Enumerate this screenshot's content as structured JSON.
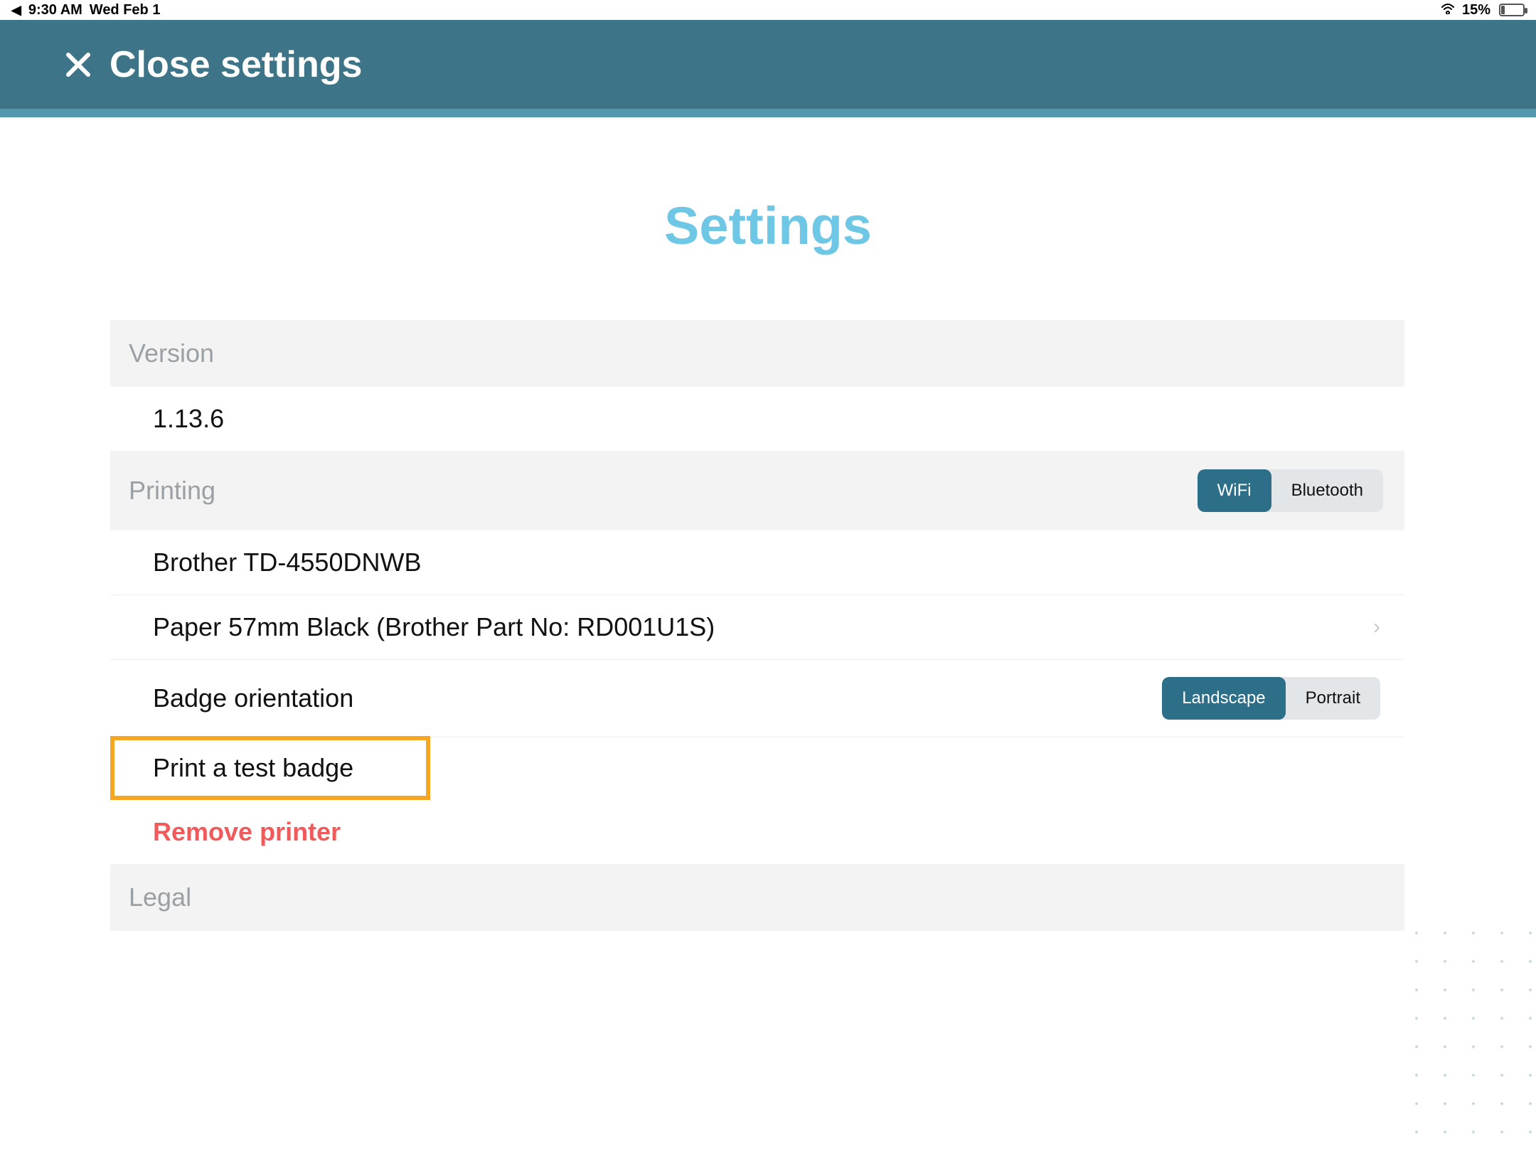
{
  "statusbar": {
    "time": "9:30 AM",
    "date": "Wed Feb 1",
    "battery_pct": "15%"
  },
  "topbar": {
    "close_label": "Close settings"
  },
  "page": {
    "title": "Settings"
  },
  "sections": {
    "version": {
      "header": "Version",
      "value": "1.13.6"
    },
    "printing": {
      "header": "Printing",
      "conn_toggle": {
        "wifi": "WiFi",
        "bluetooth": "Bluetooth",
        "active": "wifi"
      },
      "printer_name": "Brother TD-4550DNWB",
      "paper": "Paper 57mm Black (Brother Part No: RD001U1S)",
      "orientation_label": "Badge orientation",
      "orientation_toggle": {
        "landscape": "Landscape",
        "portrait": "Portrait",
        "active": "landscape"
      },
      "test_badge": "Print a test badge",
      "remove": "Remove printer"
    },
    "legal": {
      "header": "Legal"
    }
  },
  "colors": {
    "header_bg": "#3e7488",
    "accent": "#6fc7e6",
    "danger": "#f15a5a",
    "highlight_border": "#f5a623"
  }
}
